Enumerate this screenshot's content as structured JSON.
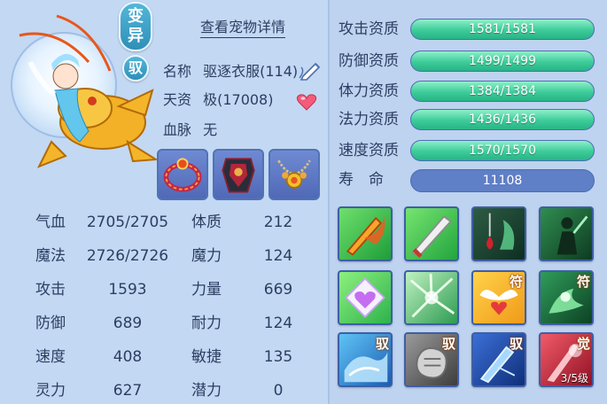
{
  "pet": {
    "variant_badge": "变异",
    "ride_badge": "驭",
    "details_link": "查看宠物详情",
    "name_label": "名称",
    "name_value": "驱逐衣服(114)",
    "talent_label": "天资",
    "talent_value": "极(17008)",
    "blood_label": "血脉",
    "blood_value": "无"
  },
  "equipment": [
    {
      "icon": "ring-icon"
    },
    {
      "icon": "armor-icon"
    },
    {
      "icon": "necklace-icon"
    }
  ],
  "stats": [
    {
      "label": "气血",
      "value": "2705/2705",
      "attr_label": "体质",
      "attr_value": "212"
    },
    {
      "label": "魔法",
      "value": "2726/2726",
      "attr_label": "魔力",
      "attr_value": "124"
    },
    {
      "label": "攻击",
      "value": "1593",
      "attr_label": "力量",
      "attr_value": "669"
    },
    {
      "label": "防御",
      "value": "689",
      "attr_label": "耐力",
      "attr_value": "124"
    },
    {
      "label": "速度",
      "value": "408",
      "attr_label": "敏捷",
      "attr_value": "135"
    },
    {
      "label": "灵力",
      "value": "627",
      "attr_label": "潜力",
      "attr_value": "0"
    }
  ],
  "qualities": [
    {
      "label": "攻击资质",
      "value": "1581/1581",
      "fill": 1.0
    },
    {
      "label": "防御资质",
      "value": "1499/1499",
      "fill": 1.0
    },
    {
      "label": "体力资质",
      "value": "1384/1384",
      "fill": 1.0
    },
    {
      "label": "法力资质",
      "value": "1436/1436",
      "fill": 1.0
    },
    {
      "label": "速度资质",
      "value": "1570/1570",
      "fill": 1.0
    }
  ],
  "life": {
    "label": "寿　命",
    "value": "11108"
  },
  "skills": [
    {
      "icon": "flame-sword-icon",
      "tag": "",
      "level": ""
    },
    {
      "icon": "sword-slash-icon",
      "tag": "",
      "level": ""
    },
    {
      "icon": "blood-drop-icon",
      "tag": "",
      "level": ""
    },
    {
      "icon": "shadow-warrior-icon",
      "tag": "",
      "level": ""
    },
    {
      "icon": "heart-shield-icon",
      "tag": "",
      "level": ""
    },
    {
      "icon": "green-burst-icon",
      "tag": "",
      "level": ""
    },
    {
      "icon": "wing-charm-icon",
      "tag": "符",
      "level": ""
    },
    {
      "icon": "green-spirit-icon",
      "tag": "符",
      "level": ""
    },
    {
      "icon": "blue-wave-icon",
      "tag": "驭",
      "level": ""
    },
    {
      "icon": "grey-fist-icon",
      "tag": "驭",
      "level": ""
    },
    {
      "icon": "blue-blade-icon",
      "tag": "驭",
      "level": ""
    },
    {
      "icon": "red-awaken-icon",
      "tag": "觉",
      "level": "3/5级"
    }
  ]
}
